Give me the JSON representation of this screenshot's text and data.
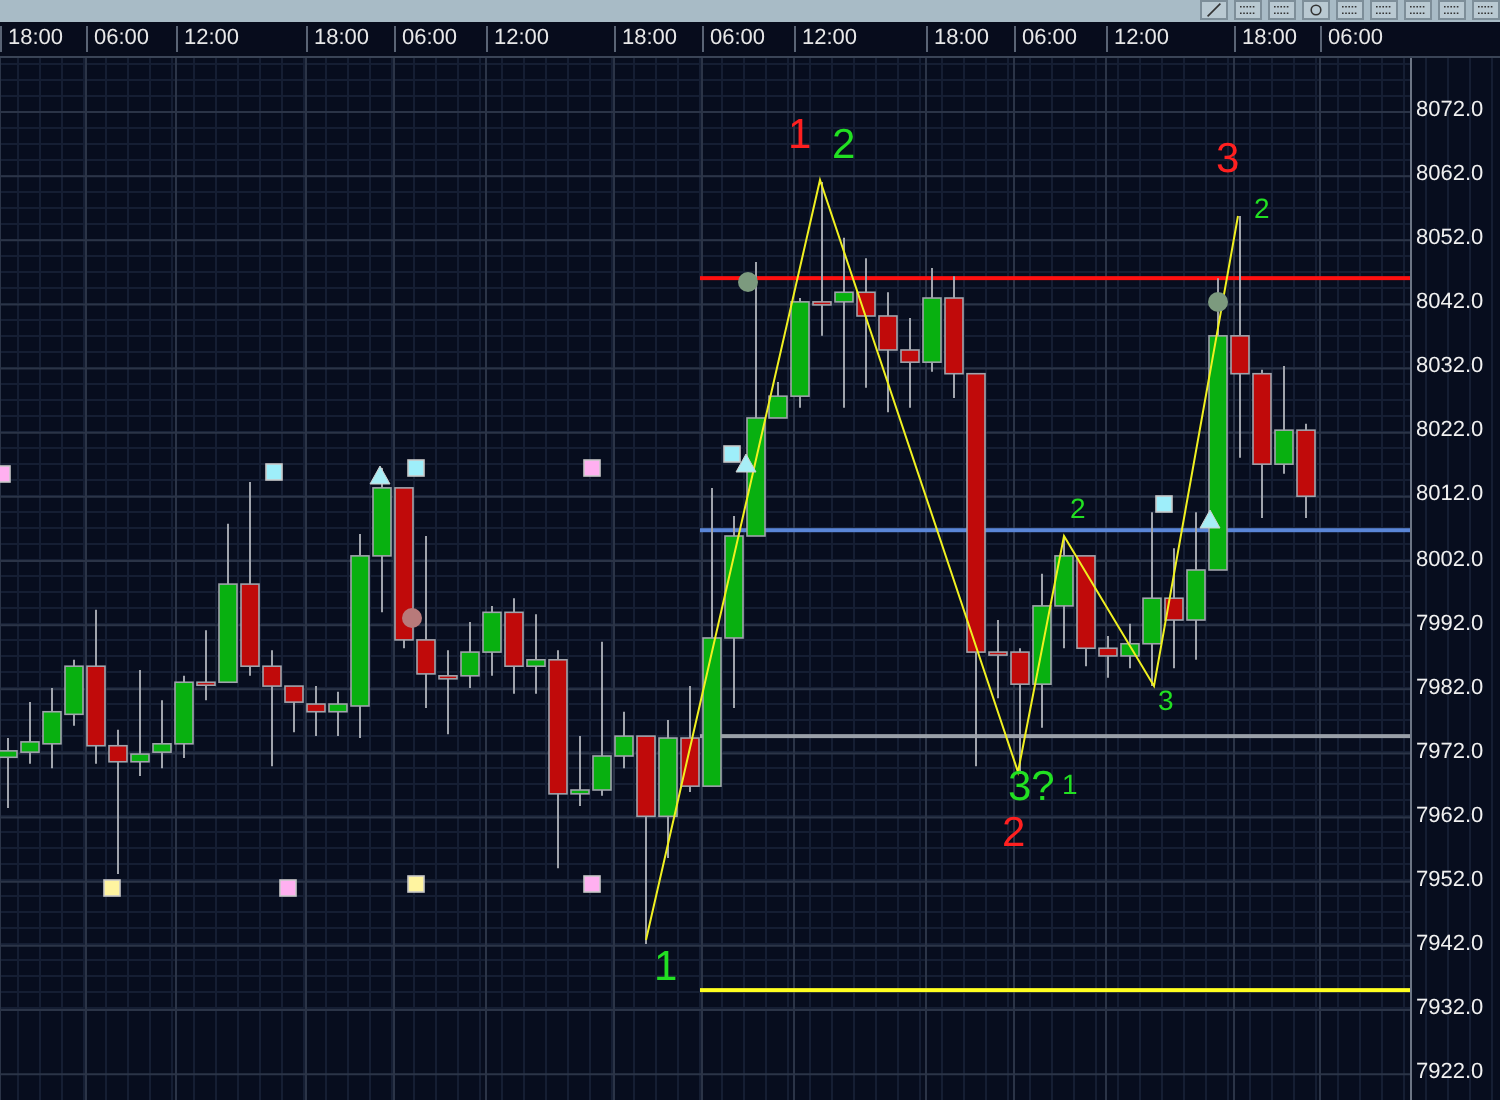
{
  "time_axis": {
    "labels": [
      "18:00",
      "06:00",
      "12:00",
      "18:00",
      "06:00",
      "12:00",
      "18:00",
      "06:00",
      "12:00",
      "18:00",
      "06:00",
      "12:00",
      "18:00",
      "06:00"
    ]
  },
  "chart_data": {
    "type": "candlestick",
    "grid": true,
    "ylim": [
      7917.97,
      8080.42
    ],
    "categories": [
      null,
      null,
      null,
      null,
      null,
      null,
      null,
      null,
      null,
      null,
      null,
      null,
      null,
      null,
      null,
      null,
      null,
      null,
      null,
      null,
      null,
      null,
      null,
      null,
      null,
      null,
      null,
      null,
      null,
      null,
      null,
      null,
      null,
      null,
      null,
      null,
      null,
      null,
      null,
      null,
      null,
      null,
      null,
      null,
      null,
      null,
      null,
      null,
      null,
      null,
      null,
      null,
      null,
      null,
      null,
      null,
      null,
      null,
      null,
      null
    ],
    "ref_lines": [
      {
        "axis": "y",
        "value": 8046.1,
        "color": "#ff1010"
      },
      {
        "axis": "y",
        "value": 8006.8,
        "color": "#5a86d8"
      },
      {
        "axis": "y",
        "value": 7974.7,
        "color": "#9aa0a8"
      },
      {
        "axis": "y",
        "value": 7935.1,
        "color": "#ffff20"
      }
    ],
    "ohlc": [
      [
        7971.4,
        7974.4,
        7963.5,
        7972.4
      ],
      [
        7972.2,
        7980,
        7970.4,
        7973.8
      ],
      [
        7973.5,
        7982.2,
        7969.7,
        7978.5
      ],
      [
        7978.1,
        7986.6,
        7976.3,
        7985.6
      ],
      [
        7985.6,
        7994.4,
        7970.4,
        7973.2
      ],
      [
        7973.2,
        7975.7,
        7953.2,
        7970.7
      ],
      [
        7970.7,
        7985,
        7968.5,
        7971.9
      ],
      [
        7972.2,
        7980.3,
        7969.7,
        7973.5
      ],
      [
        7973.5,
        7984.1,
        7971.3,
        7983.1
      ],
      [
        7983.1,
        7991.2,
        7980.3,
        7983.1
      ],
      [
        7983.1,
        8007.8,
        7983.1,
        7998.4
      ],
      [
        7998.4,
        8014.3,
        7984.1,
        7985.6
      ],
      [
        7985.6,
        7988.1,
        7970,
        7982.5
      ],
      [
        7982.5,
        7982.5,
        7975.3,
        7980
      ],
      [
        7979.7,
        7982.5,
        7974.7,
        7978.5
      ],
      [
        7978.5,
        7981.6,
        7974.7,
        7979.7
      ],
      [
        7979.4,
        8006.2,
        7974.4,
        8002.8
      ],
      [
        8002.8,
        8016.5,
        7994,
        8013.4
      ],
      [
        8013.4,
        8013.4,
        7988.4,
        7989.7
      ],
      [
        7989.7,
        8005.9,
        7979.1,
        7984.4
      ],
      [
        7984.1,
        7988.1,
        7975,
        7984.1
      ],
      [
        7984.1,
        7992.5,
        7982.2,
        7987.8
      ],
      [
        7987.8,
        7995,
        7984.1,
        7994
      ],
      [
        7994,
        7996.2,
        7981.3,
        7985.6
      ],
      [
        7985.6,
        7993.7,
        7981.3,
        7986.6
      ],
      [
        7986.6,
        7988.1,
        7954.1,
        7965.7
      ],
      [
        7965.7,
        7974.7,
        7963.8,
        7966.3
      ],
      [
        7966.3,
        7989.4,
        7965.4,
        7971.6
      ],
      [
        7971.6,
        7978.5,
        7969.7,
        7974.7
      ],
      [
        7974.7,
        7974.7,
        7942.3,
        7962.2
      ],
      [
        7962.2,
        7977.2,
        7955.7,
        7974.4
      ],
      [
        7974.4,
        7982.5,
        7966,
        7966.9
      ],
      [
        7966.9,
        8013.4,
        7966.9,
        7990
      ],
      [
        7990,
        8009,
        7979.1,
        8005.9
      ],
      [
        8005.9,
        8048.6,
        8005.9,
        8024.3
      ],
      [
        8024.3,
        8029.9,
        8024.3,
        8027.7
      ],
      [
        8027.7,
        8043,
        8025.9,
        8042.4
      ],
      [
        8042.4,
        8061.1,
        8037.1,
        8042.4
      ],
      [
        8042.4,
        8052.4,
        8025.9,
        8043.9
      ],
      [
        8043.9,
        8049.2,
        8029,
        8040.2
      ],
      [
        8040.2,
        8043.9,
        8025.2,
        8034.9
      ],
      [
        8034.9,
        8039.9,
        8025.9,
        8033
      ],
      [
        8033,
        8047.7,
        8031.5,
        8043
      ],
      [
        8043,
        8046.4,
        8027.4,
        8031.2
      ],
      [
        8031.2,
        8031.2,
        7970,
        7987.8
      ],
      [
        7987.8,
        7992.8,
        7980.6,
        7987.8
      ],
      [
        7987.8,
        7988.4,
        7968.8,
        7982.8
      ],
      [
        7982.8,
        8000,
        7976,
        7995
      ],
      [
        7995,
        8005.9,
        7988.4,
        8002.8
      ],
      [
        8002.8,
        8002.8,
        7985.6,
        7988.4
      ],
      [
        7988.4,
        7990.3,
        7983.8,
        7987.2
      ],
      [
        7987.2,
        7992.2,
        7985.3,
        7989.1
      ],
      [
        7989.1,
        8009.6,
        7982.5,
        7996.2
      ],
      [
        7996.2,
        8004,
        7985.3,
        7992.8
      ],
      [
        7992.8,
        8009.6,
        7986.6,
        8000.6
      ],
      [
        8000.6,
        8046.1,
        8000.6,
        8037.1
      ],
      [
        8037.1,
        8055.8,
        8018.1,
        8031.2
      ],
      [
        8031.2,
        8031.8,
        8008.7,
        8017.1
      ],
      [
        8017.1,
        8032.4,
        8015.6,
        8022.4
      ],
      [
        8022.4,
        8023.4,
        8008.7,
        8012.1
      ]
    ],
    "yticks": [
      {
        "value": 8072,
        "label": "8072.0"
      },
      {
        "value": 8062,
        "label": "8062.0"
      },
      {
        "value": 8052,
        "label": "8052.0"
      },
      {
        "value": 8042,
        "label": "8042.0"
      },
      {
        "value": 8032,
        "label": "8032.0"
      },
      {
        "value": 8022,
        "label": "8022.0"
      },
      {
        "value": 8012,
        "label": "8012.0"
      },
      {
        "value": 8002,
        "label": "8002.0"
      },
      {
        "value": 7992,
        "label": "7992.0"
      },
      {
        "value": 7982,
        "label": "7982.0"
      },
      {
        "value": 7972,
        "label": "7972.0"
      },
      {
        "value": 7962,
        "label": "7962.0"
      },
      {
        "value": 7952,
        "label": "7952.0"
      },
      {
        "value": 7942,
        "label": "7942.0"
      },
      {
        "value": 7932,
        "label": "7932.0"
      },
      {
        "value": 7922,
        "label": "7922.0"
      }
    ]
  },
  "wave_labels": [
    {
      "text": "1",
      "color": "#ff2020",
      "kind": "major"
    },
    {
      "text": "2",
      "color": "#22e022",
      "kind": "major"
    },
    {
      "text": "3",
      "color": "#ff2020",
      "kind": "major"
    },
    {
      "text": "2",
      "color": "#22e022",
      "kind": "minor"
    },
    {
      "text": "2",
      "color": "#22e022",
      "kind": "minor"
    },
    {
      "text": "3",
      "color": "#22e022",
      "kind": "minor"
    },
    {
      "text": "3?",
      "color": "#22e022",
      "kind": "major"
    },
    {
      "text": "1",
      "color": "#22e022",
      "kind": "minor"
    },
    {
      "text": "2",
      "color": "#ff2020",
      "kind": "major"
    },
    {
      "text": "1",
      "color": "#22e022",
      "kind": "major"
    }
  ]
}
